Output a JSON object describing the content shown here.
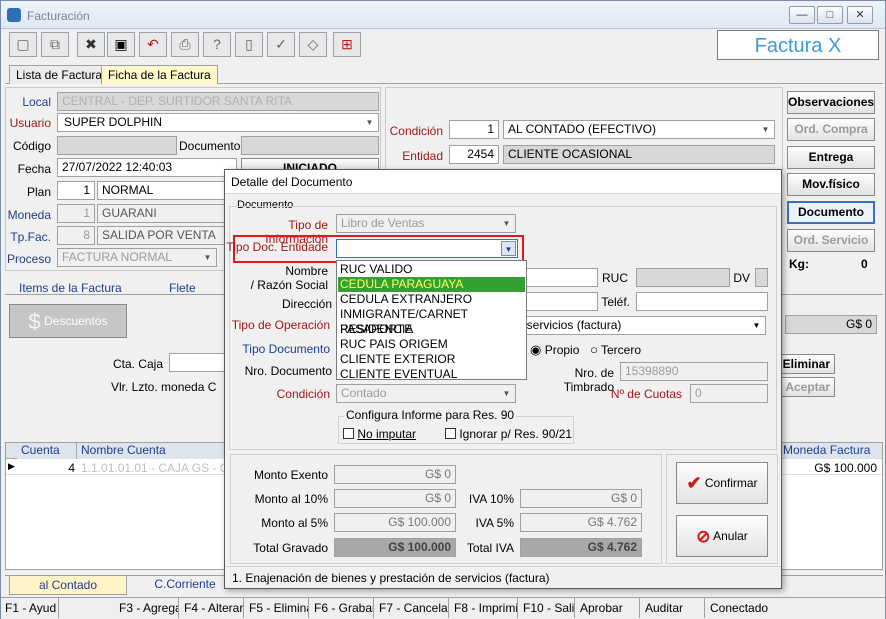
{
  "window": {
    "title": "Facturación",
    "min": "—",
    "max": "□",
    "close": "✕"
  },
  "toolbar": {
    "icons": [
      "new-icon",
      "copy-icon",
      "delete-icon",
      "save-icon",
      "undo-icon",
      "print-icon",
      "help-icon",
      "exit-icon",
      "check-icon",
      "tag-icon",
      "print-report-icon"
    ],
    "brand": "Factura X"
  },
  "tabs": [
    "Lista de Facturas",
    "Ficha de la Factura"
  ],
  "header": {
    "local_label": "Local",
    "local_value": "CENTRAL - DEP. SURTIDOR SANTA RITA",
    "usuario_label": "Usuario",
    "usuario_value": "SUPER DOLPHIN",
    "codigo_label": "Código",
    "documento_label": "Documento",
    "fecha_label": "Fecha",
    "fecha_value": "27/07/2022 12:40:03",
    "estado": "INICIADO",
    "plan_label": "Plan",
    "plan_code": "1",
    "plan_value": "NORMAL",
    "moneda_label": "Moneda",
    "moneda_code": "1",
    "moneda_value": "GUARANI",
    "tpfac_label": "Tp.Fac.",
    "tpfac_code": "8",
    "tpfac_value": "SALIDA POR VENTA",
    "proceso_label": "Proceso",
    "proceso_value": "FACTURA NORMAL",
    "condicion_label": "Condición",
    "condicion_code": "1",
    "condicion_value": "AL CONTADO (EFECTIVO)",
    "entidad_label": "Entidad",
    "entidad_code": "2454",
    "entidad_value": "CLIENTE OCASIONAL"
  },
  "side_buttons": {
    "observaciones": "Observaciones",
    "ord_compra": "Ord. Compra",
    "entrega": "Entrega",
    "mov_fisico": "Mov.físico",
    "documento": "Documento",
    "ord_servicio": "Ord. Servicio",
    "kg_label": "Kg:",
    "kg_value": "0"
  },
  "subtabs": [
    "Items de la Factura",
    "Flete"
  ],
  "descuentos": "Descuentos",
  "cta_caja_label": "Cta. Caja",
  "vlr_label": "Vlr. Lzto. moneda C",
  "right_gs": "G$ 0",
  "eliminar": "Eliminar",
  "aceptar": "Aceptar",
  "grid": {
    "headers": [
      "Cuenta",
      "Nombre Cuenta",
      "Moneda Factura"
    ],
    "row": {
      "cuenta": "4",
      "nombre": "1.1.01.01.01 - CAJA GS - GER",
      "monto": "G$ 100.000"
    }
  },
  "bottom_tabs": [
    "al Contado",
    "C.Corriente"
  ],
  "status": [
    "F1 - Ayud",
    "F3 - Agrega",
    "F4 - Alterar",
    "F5 - Elimina",
    "F6 - Grabar",
    "F7 - Cancelar",
    "F8 - Imprimi",
    "F10 - Salir",
    "Aprobar",
    "Auditar",
    "Conectado"
  ],
  "dialog": {
    "title": "Detalle del Documento",
    "group": "Documento",
    "tipo_info_label": "Tipo de Información",
    "tipo_info_value": "Libro de Ventas",
    "tipo_doc_label": "Tipo Doc. Entidade",
    "tipo_doc_value": "",
    "nombre_label1": "Nombre",
    "nombre_label2": "/ Razón Social",
    "ruc_label": "RUC",
    "dv_label": "DV",
    "direccion_label": "Dirección",
    "telef_label": "Teléf.",
    "tipo_op_label": "Tipo de Operación",
    "tipo_op_value": "de servicios (factura)",
    "tipo_documento_label": "Tipo Documento",
    "propio": "Propio",
    "tercero": "Tercero",
    "nro_doc_label": "Nro. Documento",
    "nro_timbrado_label": "Nro. de Timbrado",
    "nro_timbrado_value": "15398890",
    "condicion_label": "Condición",
    "condicion_value": "Contado",
    "cuotas_label": "Nº de Cuotas",
    "cuotas_value": "0",
    "res90_title": "Configura Informe para Res. 90",
    "no_imputar": "No imputar",
    "ignorar": "Ignorar p/ Res. 90/21",
    "options": [
      "RUC VALIDO",
      "CEDULA PARAGUAYA",
      "CEDULA EXTRANJERO",
      "INMIGRANTE/CARNET RESIDENCIA",
      "PASAPORTE",
      "RUC PAIS ORIGEM",
      "CLIENTE EXTERIOR",
      "CLIENTE EVENTUAL"
    ],
    "selected_option_index": 1,
    "monto_exento_label": "Monto Exento",
    "monto_exento": "G$ 0",
    "monto10_label": "Monto al 10%",
    "monto10": "G$ 0",
    "iva10_label": "IVA 10%",
    "iva10": "G$ 0",
    "monto5_label": "Monto al 5%",
    "monto5": "G$ 100.000",
    "iva5_label": "IVA 5%",
    "iva5": "G$ 4.762",
    "total_gravado_label": "Total Gravado",
    "total_gravado": "G$ 100.000",
    "total_iva_label": "Total IVA",
    "total_iva": "G$ 4.762",
    "confirmar": "Confirmar",
    "anular": "Anular",
    "footer": "1. Enajenación de bienes y prestación de servicios (factura)"
  },
  "colors": {
    "accent_blue": "#3f9ad3",
    "label_blue": "#1e3e8a",
    "label_red": "#a01818",
    "selection_green": "#32a132",
    "highlight_red": "#e01818"
  }
}
